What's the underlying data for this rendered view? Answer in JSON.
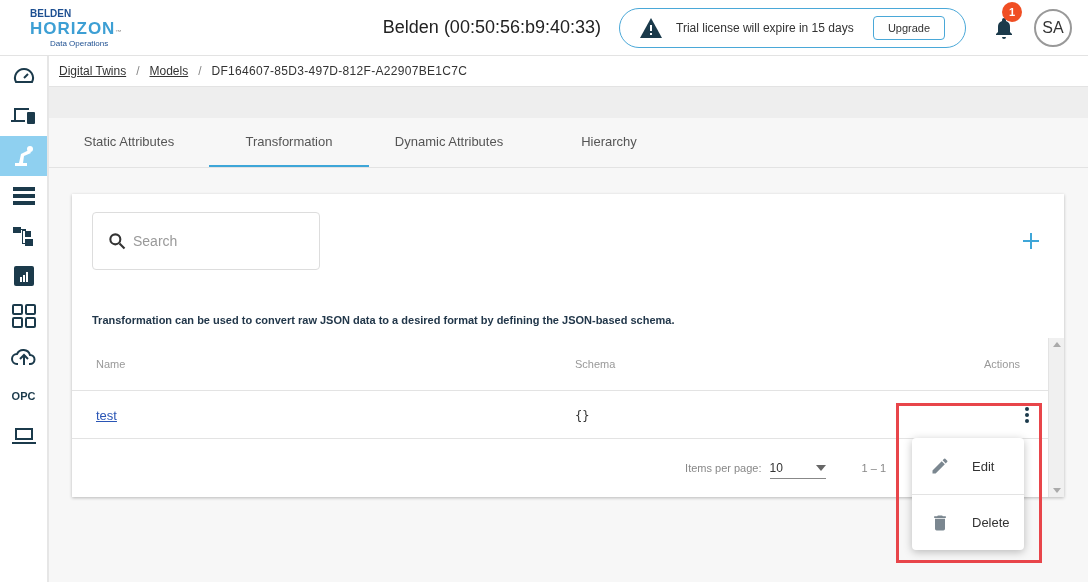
{
  "header": {
    "logo": {
      "brand": "BELDEN",
      "product": "HORIZON",
      "trademark": "™",
      "tagline": "Data Operations"
    },
    "title": "Belden (00:50:56:b9:40:33)",
    "license": {
      "message": "Trial license will expire in 15 days",
      "button": "Upgrade"
    },
    "notifications": {
      "count": "1"
    },
    "avatar": "SA"
  },
  "sidebar": {
    "items": [
      {
        "kind": "gauge",
        "selected": false
      },
      {
        "kind": "devices",
        "selected": false
      },
      {
        "kind": "robot",
        "selected": true
      },
      {
        "kind": "list",
        "selected": false
      },
      {
        "kind": "tree",
        "selected": false
      },
      {
        "kind": "chart",
        "selected": false
      },
      {
        "kind": "grid",
        "selected": false
      },
      {
        "kind": "cloud",
        "selected": false
      },
      {
        "kind": "text",
        "label": "OPC",
        "selected": false
      },
      {
        "kind": "laptop",
        "selected": false
      }
    ]
  },
  "breadcrumb": {
    "separator": "/",
    "items": [
      {
        "label": "Digital Twins",
        "link": true
      },
      {
        "label": "Models",
        "link": true
      },
      {
        "label": "DF164607-85D3-497D-812F-A22907BE1C7C",
        "link": false
      }
    ]
  },
  "tabs": [
    {
      "label": "Static Attributes",
      "selected": false
    },
    {
      "label": "Transformation",
      "selected": true
    },
    {
      "label": "Dynamic Attributes",
      "selected": false
    },
    {
      "label": "Hierarchy",
      "selected": false
    }
  ],
  "search": {
    "placeholder": "Search"
  },
  "description": "Transformation can be used to convert raw JSON data to a desired format by defining the JSON-based schema.",
  "table": {
    "columns": [
      "Name",
      "Schema",
      "Actions"
    ],
    "rows": [
      {
        "name": "test",
        "schema": "{}"
      }
    ]
  },
  "paginator": {
    "label": "Items per page:",
    "page_size": "10",
    "range": "1 – 1"
  },
  "menu": {
    "items": [
      {
        "kind": "edit",
        "label": "Edit"
      },
      {
        "kind": "delete",
        "label": "Delete"
      }
    ]
  }
}
